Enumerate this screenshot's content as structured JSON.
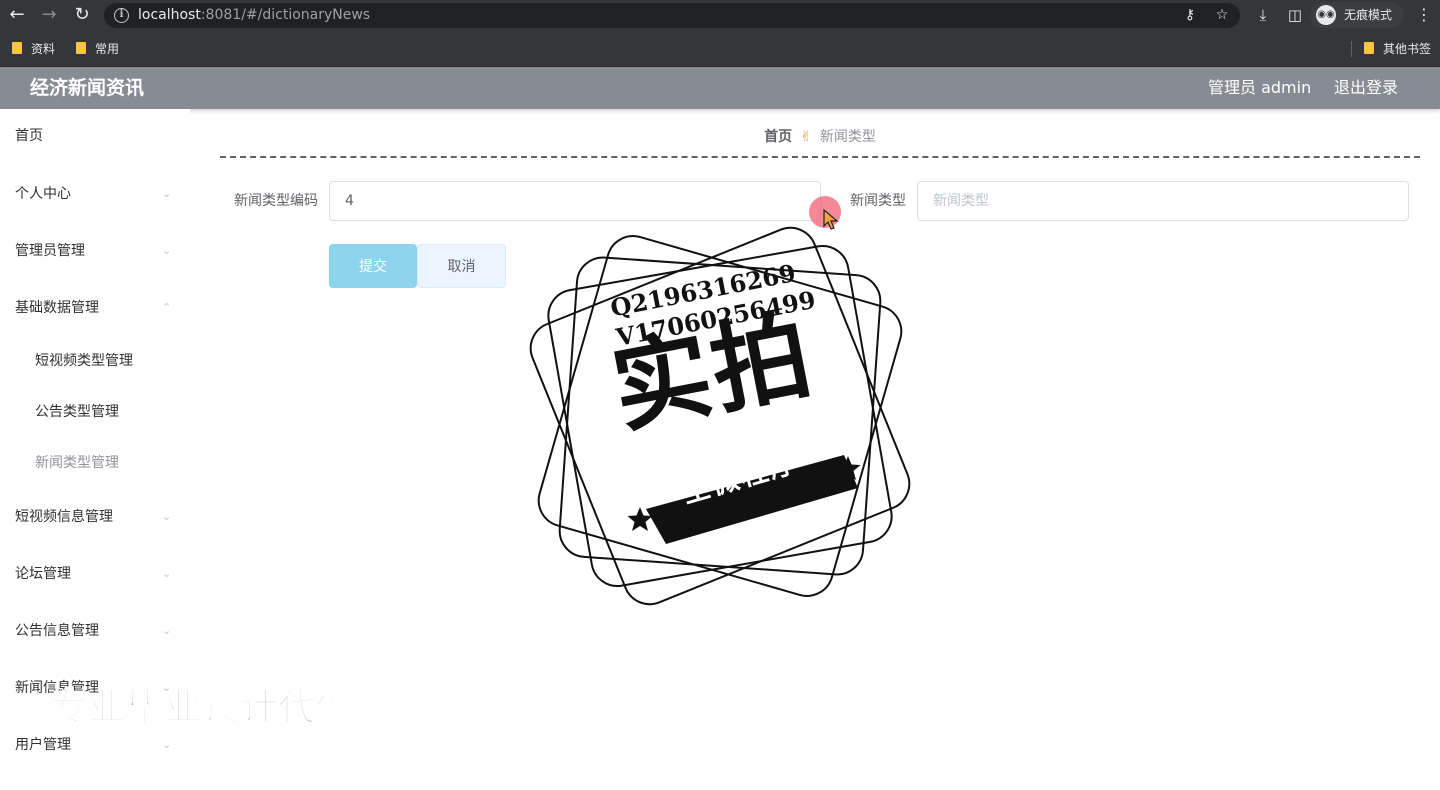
{
  "browser": {
    "url_host": "localhost",
    "url_port_path": ":8081/#/dictionaryNews",
    "profile_label": "无痕模式",
    "bookmarks": [
      "资料",
      "常用"
    ],
    "other_bookmarks": "其他书签"
  },
  "header": {
    "title": "经济新闻资讯",
    "admin_label": "管理员 admin",
    "logout_label": "退出登录"
  },
  "sidebar": {
    "items": [
      {
        "label": "首页"
      },
      {
        "label": "个人中心"
      },
      {
        "label": "管理员管理"
      },
      {
        "label": "基础数据管理"
      },
      {
        "label": "短视频类型管理"
      },
      {
        "label": "公告类型管理"
      },
      {
        "label": "新闻类型管理"
      },
      {
        "label": "短视频信息管理"
      },
      {
        "label": "论坛管理"
      },
      {
        "label": "公告信息管理"
      },
      {
        "label": "新闻信息管理"
      },
      {
        "label": "用户管理"
      }
    ]
  },
  "breadcrumb": {
    "home": "首页",
    "current": "新闻类型"
  },
  "form": {
    "code_label": "新闻类型编码",
    "code_value": "4",
    "type_label": "新闻类型",
    "type_placeholder": "新闻类型",
    "submit_label": "提交",
    "cancel_label": "取消"
  },
  "watermark": {
    "qq": "Q2196316269",
    "wechat": "V17060256499",
    "big_text": "实拍",
    "ribbon_text": "全微程序",
    "footer_text": "专业毕业设计代做"
  },
  "colors": {
    "header_bg": "#868b94",
    "submit_bg": "#8fd4ee",
    "cancel_bg": "#ecf5ff"
  }
}
